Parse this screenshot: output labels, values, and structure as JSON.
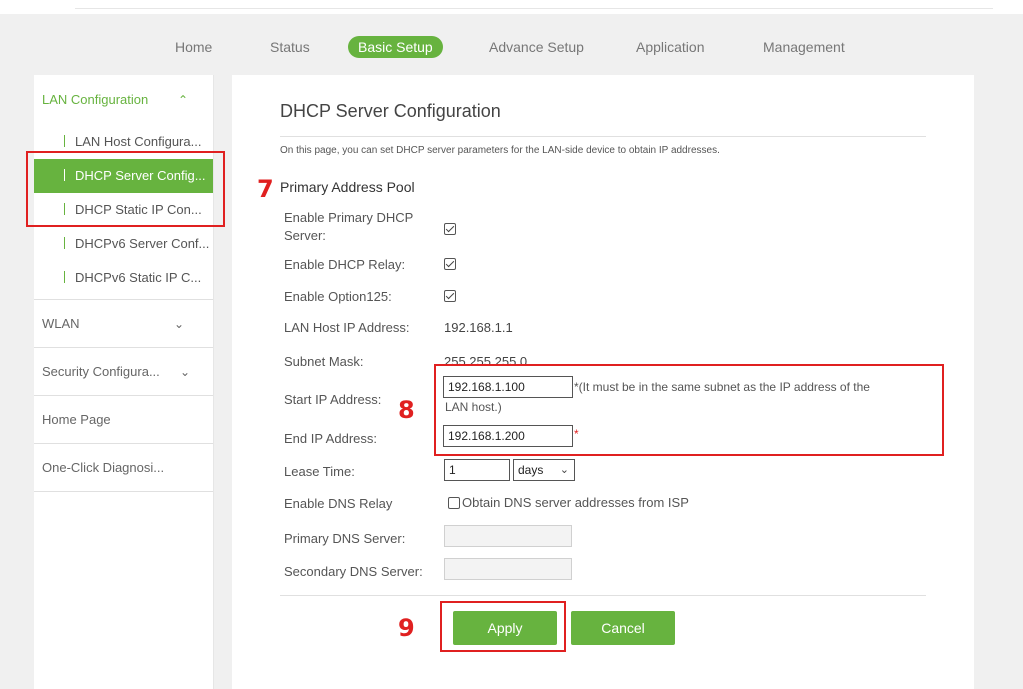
{
  "nav": {
    "items": [
      "Home",
      "Status",
      "Basic Setup",
      "Advance Setup",
      "Application",
      "Management"
    ],
    "active": "Basic Setup"
  },
  "sidebar": {
    "lan_group": "LAN Configuration",
    "lan_items": [
      "LAN Host Configura...",
      "DHCP Server Config...",
      "DHCP Static IP Con...",
      "DHCPv6 Server Conf...",
      "DHCPv6 Static IP C..."
    ],
    "groups": [
      "WLAN",
      "Security Configura...",
      "Home Page",
      "One-Click Diagnosi..."
    ]
  },
  "page": {
    "title": "DHCP Server Configuration",
    "intro": "On this page, you can set DHCP server parameters for the LAN-side device to obtain IP addresses.",
    "section": "Primary Address Pool"
  },
  "form": {
    "enable_primary_label_1": "Enable Primary DHCP",
    "enable_primary_label_2": "Server:",
    "enable_relay_label": "Enable DHCP Relay:",
    "enable_option125_label": "Enable Option125:",
    "lan_host_ip_label": "LAN Host IP Address:",
    "lan_host_ip_value": "192.168.1.1",
    "subnet_mask_label": "Subnet Mask:",
    "subnet_mask_value": "255.255.255.0",
    "start_ip_label": "Start IP Address:",
    "start_ip_value": "192.168.1.100",
    "start_ip_note_1": "*(It must be in the same subnet as the IP address of the",
    "start_ip_note_2": "LAN host.)",
    "end_ip_label": "End IP Address:",
    "end_ip_value": "192.168.1.200",
    "required_mark": "*",
    "lease_time_label": "Lease Time:",
    "lease_time_value": "1",
    "lease_unit": "days",
    "dns_relay_label": "Enable DNS Relay",
    "dns_relay_option": "Obtain DNS server addresses from ISP",
    "primary_dns_label": "Primary DNS Server:",
    "secondary_dns_label": "Secondary DNS Server:",
    "primary_dns_value": "",
    "secondary_dns_value": ""
  },
  "buttons": {
    "apply": "Apply",
    "cancel": "Cancel"
  },
  "callouts": {
    "seven": "7",
    "eight": "8",
    "nine": "9"
  },
  "colors": {
    "accent": "#67b33f",
    "callout": "#e02020"
  }
}
